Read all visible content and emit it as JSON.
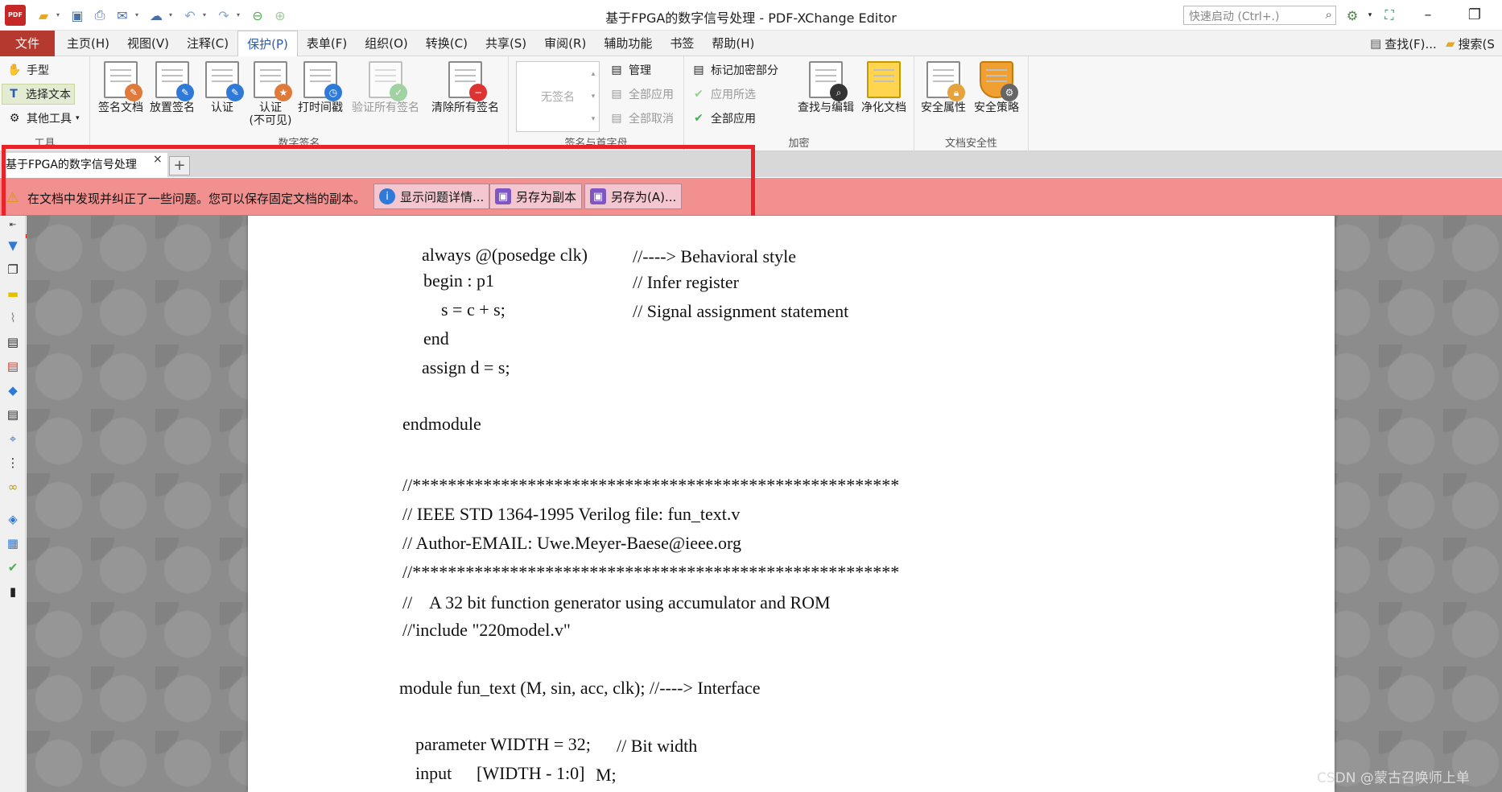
{
  "window": {
    "title": "基于FPGA的数字信号处理 - PDF-XChange Editor",
    "logo_text": "PDF",
    "quick_launch_placeholder": "快速启动 (Ctrl+.)"
  },
  "menu": {
    "file": "文件",
    "items": [
      "主页(H)",
      "视图(V)",
      "注释(C)",
      "保护(P)",
      "表单(F)",
      "组织(O)",
      "转换(C)",
      "共享(S)",
      "审阅(R)",
      "辅助功能",
      "书签",
      "帮助(H)"
    ],
    "active_index": 3,
    "find": "查找(F)...",
    "search": "搜索(S"
  },
  "ribbon": {
    "tools": {
      "hand": "手型",
      "select_text": "选择文本",
      "other_tools": "其他工具",
      "label": "工具"
    },
    "digital_sign": {
      "sign_doc": "签名文档",
      "place_sig": "放置签名",
      "certify": "认证",
      "certify_invisible_1": "认证",
      "certify_invisible_2": "(不可见)",
      "timestamp": "打时间戳",
      "verify_all": "验证所有签名",
      "clear_all": "清除所有签名",
      "label": "数字签名"
    },
    "sig_stamp": {
      "no_sig": "无签名",
      "manage": "管理",
      "apply_all": "全部应用",
      "cancel_all": "全部取消",
      "label": "签名与首字母"
    },
    "redact": {
      "mark": "标记加密部分",
      "apply_selected": "应用所选",
      "apply_all": "全部应用",
      "find_edit": "查找与编辑",
      "sanitize": "净化文档",
      "label": "加密"
    },
    "security": {
      "props": "安全属性",
      "policy": "安全策略",
      "label": "文档安全性"
    }
  },
  "doc_tab": {
    "name": "基于FPGA的数字信号处理",
    "close": "×",
    "add": "+"
  },
  "notice": {
    "text": "在文档中发现并纠正了一些问题。您可以保存固定文档的副本。",
    "show_details": "显示问题详情...",
    "save_copy": "另存为副本",
    "save_as": "另存为(A)..."
  },
  "code_lines": [
    "always @(posedge clk)",
    "//----> Behavioral style",
    "begin : p1",
    "// Infer register",
    "s = c + s;",
    "// Signal assignment statement",
    "end",
    "assign d = s;",
    "endmodule",
    "//*******************************************************",
    "// IEEE STD 1364-1995 Verilog file: fun_text.v",
    "// Author-EMAIL: Uwe.Meyer-Baese@ieee.org",
    "//*******************************************************",
    "//    A 32 bit function generator using accumulator and ROM",
    "//'include \"220model.v\"",
    "module fun_text (M, sin, acc, clk); //----> Interface",
    "parameter WIDTH = 32;",
    "// Bit width",
    "input",
    "[WIDTH - 1:0]",
    "M;"
  ],
  "watermark": "CSDN @蒙古召唤师上单",
  "colors": {
    "file_tab": "#b5392e",
    "notice_bg": "#f28f8f",
    "highlight": "#e8232a",
    "active_menu": "#2a5db0"
  }
}
